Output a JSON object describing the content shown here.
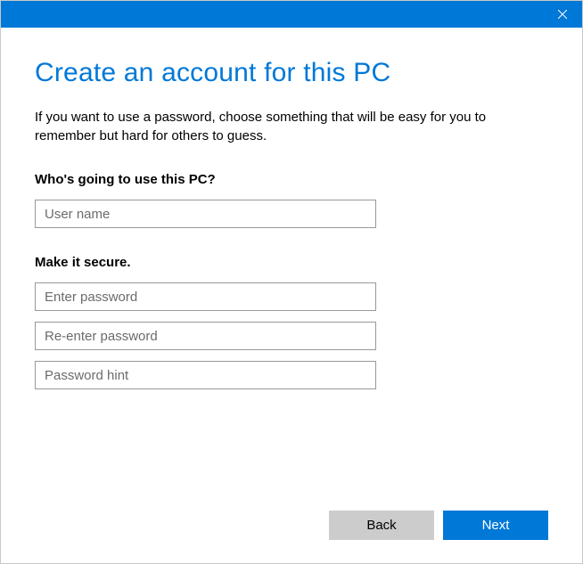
{
  "colors": {
    "accent": "#0078d7"
  },
  "titlebar": {
    "close_icon": "close"
  },
  "page": {
    "title": "Create an account for this PC",
    "description": "If you want to use a password, choose something that will be easy for you to remember but hard for others to guess."
  },
  "sections": {
    "user": {
      "label": "Who's going to use this PC?",
      "username_placeholder": "User name",
      "username_value": ""
    },
    "security": {
      "label": "Make it secure.",
      "password_placeholder": "Enter password",
      "password_value": "",
      "confirm_placeholder": "Re-enter password",
      "confirm_value": "",
      "hint_placeholder": "Password hint",
      "hint_value": ""
    }
  },
  "footer": {
    "back_label": "Back",
    "next_label": "Next"
  }
}
